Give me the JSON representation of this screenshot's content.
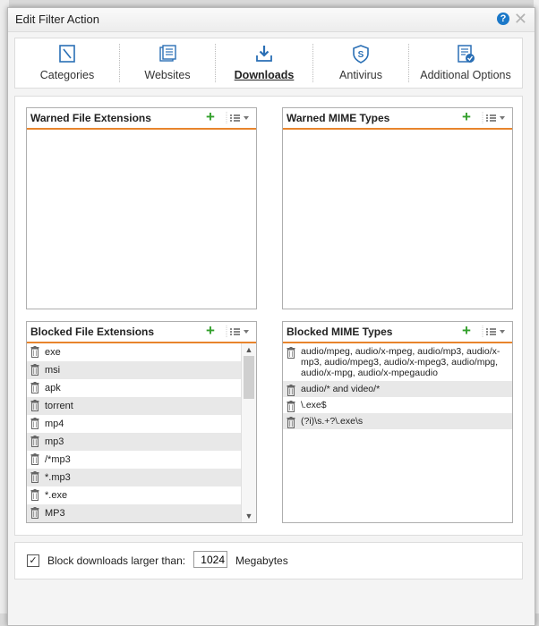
{
  "dialog": {
    "title": "Edit Filter Action",
    "help_icon": "help-icon",
    "close_icon": "close-icon"
  },
  "tabs": [
    {
      "label": "Categories",
      "icon": "categories-icon",
      "active": false
    },
    {
      "label": "Websites",
      "icon": "websites-icon",
      "active": false
    },
    {
      "label": "Downloads",
      "icon": "downloads-icon",
      "active": true
    },
    {
      "label": "Antivirus",
      "icon": "antivirus-icon",
      "active": false
    },
    {
      "label": "Additional Options",
      "icon": "additional-options-icon",
      "active": false
    }
  ],
  "panels": {
    "warned_file_extensions": {
      "title": "Warned File Extensions",
      "items": []
    },
    "warned_mime_types": {
      "title": "Warned MIME Types",
      "items": []
    },
    "blocked_file_extensions": {
      "title": "Blocked File Extensions",
      "items": [
        "exe",
        "msi",
        "apk",
        "torrent",
        "mp4",
        "mp3",
        "/*mp3",
        "*.mp3",
        "*.exe",
        "MP3"
      ]
    },
    "blocked_mime_types": {
      "title": "Blocked MIME Types",
      "items": [
        "audio/mpeg, audio/x-mpeg, audio/mp3, audio/x-mp3, audio/mpeg3, audio/x-mpeg3, audio/mpg, audio/x-mpg, audio/x-mpegaudio",
        "audio/* and video/*",
        "\\.exe$",
        "(?i)\\s.+?\\.exe\\s"
      ]
    }
  },
  "footer": {
    "checkbox_checked": true,
    "label": "Block downloads larger than:",
    "size_value": "1024",
    "unit": "Megabytes"
  },
  "colors": {
    "accent_orange": "#e8842c",
    "add_green": "#33a02c",
    "help_blue": "#1b78c8"
  }
}
